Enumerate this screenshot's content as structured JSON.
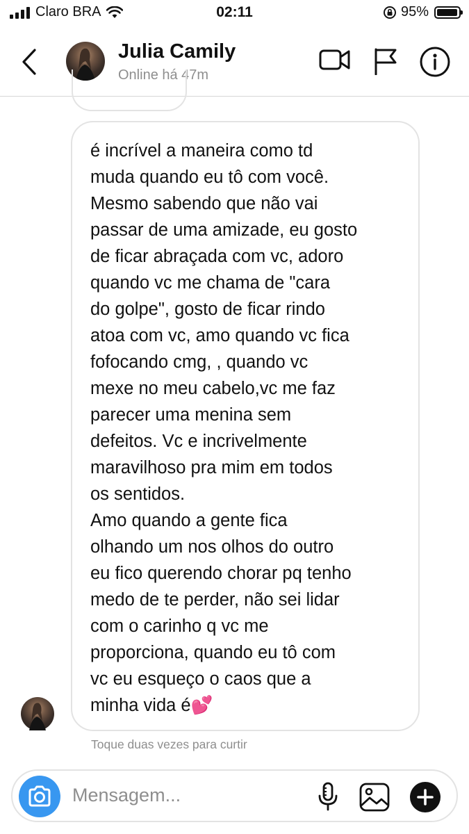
{
  "status_bar": {
    "carrier": "Claro BRA",
    "time": "02:11",
    "battery_percent": "95%",
    "battery_level": 0.95
  },
  "header": {
    "contact_name": "Julia Camily",
    "contact_status": "Online há 47m",
    "icons": [
      "back-icon",
      "video-call-icon",
      "flag-icon",
      "info-icon"
    ]
  },
  "message": {
    "text": "é incrível a maneira como td\nmuda quando eu tô com você.\nMesmo sabendo que não vai\npassar de uma amizade, eu gosto\nde ficar abraçada com vc, adoro\nquando vc me chama de \"cara\ndo golpe\", gosto de ficar rindo\natoa com vc, amo quando vc fica\nfofocando cmg, , quando vc\nmexe no meu cabelo,vc me faz\nparecer uma menina sem\ndefeitos. Vc e incrivelmente\nmaravilhoso pra mim em todos\nos sentidos.\nAmo quando a gente fica\nolhando um nos olhos do outro\neu fico querendo chorar pq tenho\nmedo de te perder, não sei lidar\ncom o carinho q vc me\nproporciona, quando eu tô com\nvc eu esqueço o caos que a\nminha vida é",
    "emoji": "💕",
    "hint": "Toque duas vezes para curtir"
  },
  "composer": {
    "placeholder": "Mensagem...",
    "icons": [
      "camera-icon",
      "microphone-icon",
      "gallery-icon",
      "add-icon"
    ]
  },
  "colors": {
    "accent": "#3897f0",
    "secondary_text": "#8e8e8e",
    "border": "#e3e3e3"
  }
}
